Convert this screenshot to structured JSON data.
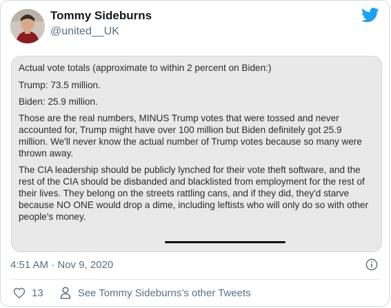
{
  "author": {
    "name": "Tommy Sideburns",
    "handle": "@united__UK"
  },
  "media": {
    "paragraphs": [
      "Actual vote totals (approximate to within 2 percent on Biden:)",
      "Trump: 73.5 million.",
      "Biden: 25.9 million.",
      "Those are the real numbers, MINUS Trump votes that were tossed and never accounted for, Trump might have over 100 million but Biden definitely got 25.9 million. We'll never know the actual number of Trump votes because so many were thrown away.",
      "The CIA leadership should be publicly lynched for their vote theft software, and the rest of the CIA should be disbanded and blacklisted from employment for the rest of their lives. They belong on the streets rattling cans, and if they did, they'd starve because NO ONE would drop a dime, including leftists who will only do so with other people's money."
    ]
  },
  "timestamp": "4:51 AM · Nov 9, 2020",
  "footer": {
    "like_count": "13",
    "other_tweets_link": "See Tommy Sideburns’s other Tweets"
  },
  "icons": {
    "logo": "twitter-bird-icon",
    "info": "info-icon",
    "like": "heart-icon",
    "profile": "person-icon"
  },
  "colors": {
    "brand_blue": "#1da1f2",
    "secondary_text": "#5b7083",
    "media_background": "#e9e9ea"
  }
}
